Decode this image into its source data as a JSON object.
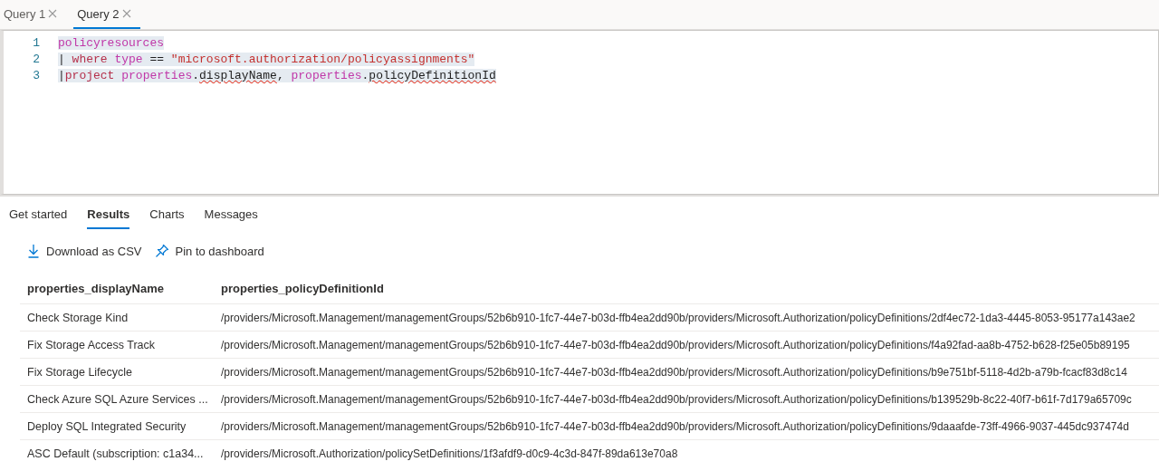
{
  "query_tabs": [
    {
      "label": "Query 1",
      "selected": false
    },
    {
      "label": "Query 2",
      "selected": true
    }
  ],
  "editor": {
    "lines": [
      {
        "number": "1",
        "tokens": [
          {
            "text": "policyresources",
            "kind": "identifier",
            "error": false
          }
        ]
      },
      {
        "number": "2",
        "tokens": [
          {
            "text": "| ",
            "kind": "operator",
            "error": false
          },
          {
            "text": "where ",
            "kind": "keyword",
            "error": false
          },
          {
            "text": "type ",
            "kind": "identifier",
            "error": false
          },
          {
            "text": "== ",
            "kind": "operator",
            "error": false
          },
          {
            "text": "\"microsoft.authorization/policyassignments\"",
            "kind": "string",
            "error": false
          }
        ]
      },
      {
        "number": "3",
        "tokens": [
          {
            "text": "|",
            "kind": "operator",
            "error": false
          },
          {
            "text": "project ",
            "kind": "keyword",
            "error": false
          },
          {
            "text": "properties",
            "kind": "identifier",
            "error": false
          },
          {
            "text": ".",
            "kind": "operator",
            "error": false
          },
          {
            "text": "displayName",
            "kind": "operator",
            "error": true
          },
          {
            "text": ", ",
            "kind": "operator",
            "error": false
          },
          {
            "text": "properties",
            "kind": "identifier",
            "error": false
          },
          {
            "text": ".",
            "kind": "operator",
            "error": false
          },
          {
            "text": "policyDefinitionId",
            "kind": "operator",
            "error": true
          }
        ]
      }
    ]
  },
  "result_tabs": [
    {
      "label": "Get started",
      "selected": false
    },
    {
      "label": "Results",
      "selected": true
    },
    {
      "label": "Charts",
      "selected": false
    },
    {
      "label": "Messages",
      "selected": false
    }
  ],
  "toolbar": {
    "download": "Download as CSV",
    "pin": "Pin to dashboard"
  },
  "table": {
    "columns": [
      "properties_displayName",
      "properties_policyDefinitionId"
    ],
    "rows": [
      [
        "Check Storage Kind",
        "/providers/Microsoft.Management/managementGroups/52b6b910-1fc7-44e7-b03d-ffb4ea2dd90b/providers/Microsoft.Authorization/policyDefinitions/2df4ec72-1da3-4445-8053-95177a143ae2"
      ],
      [
        "Fix Storage Access Track",
        "/providers/Microsoft.Management/managementGroups/52b6b910-1fc7-44e7-b03d-ffb4ea2dd90b/providers/Microsoft.Authorization/policyDefinitions/f4a92fad-aa8b-4752-b628-f25e05b89195"
      ],
      [
        "Fix Storage Lifecycle",
        "/providers/Microsoft.Management/managementGroups/52b6b910-1fc7-44e7-b03d-ffb4ea2dd90b/providers/Microsoft.Authorization/policyDefinitions/b9e751bf-5118-4d2b-a79b-fcacf83d8c14"
      ],
      [
        "Check Azure SQL Azure Services ...",
        "/providers/Microsoft.Management/managementGroups/52b6b910-1fc7-44e7-b03d-ffb4ea2dd90b/providers/Microsoft.Authorization/policyDefinitions/b139529b-8c22-40f7-b61f-7d179a65709c"
      ],
      [
        "Deploy SQL Integrated Security",
        "/providers/Microsoft.Management/managementGroups/52b6b910-1fc7-44e7-b03d-ffb4ea2dd90b/providers/Microsoft.Authorization/policyDefinitions/9daaafde-73ff-4966-9037-445dc937474d"
      ],
      [
        "ASC Default (subscription: c1a34...",
        "/providers/Microsoft.Authorization/policySetDefinitions/1f3afdf9-d0c9-4c3d-847f-89da613e70a8"
      ]
    ]
  }
}
